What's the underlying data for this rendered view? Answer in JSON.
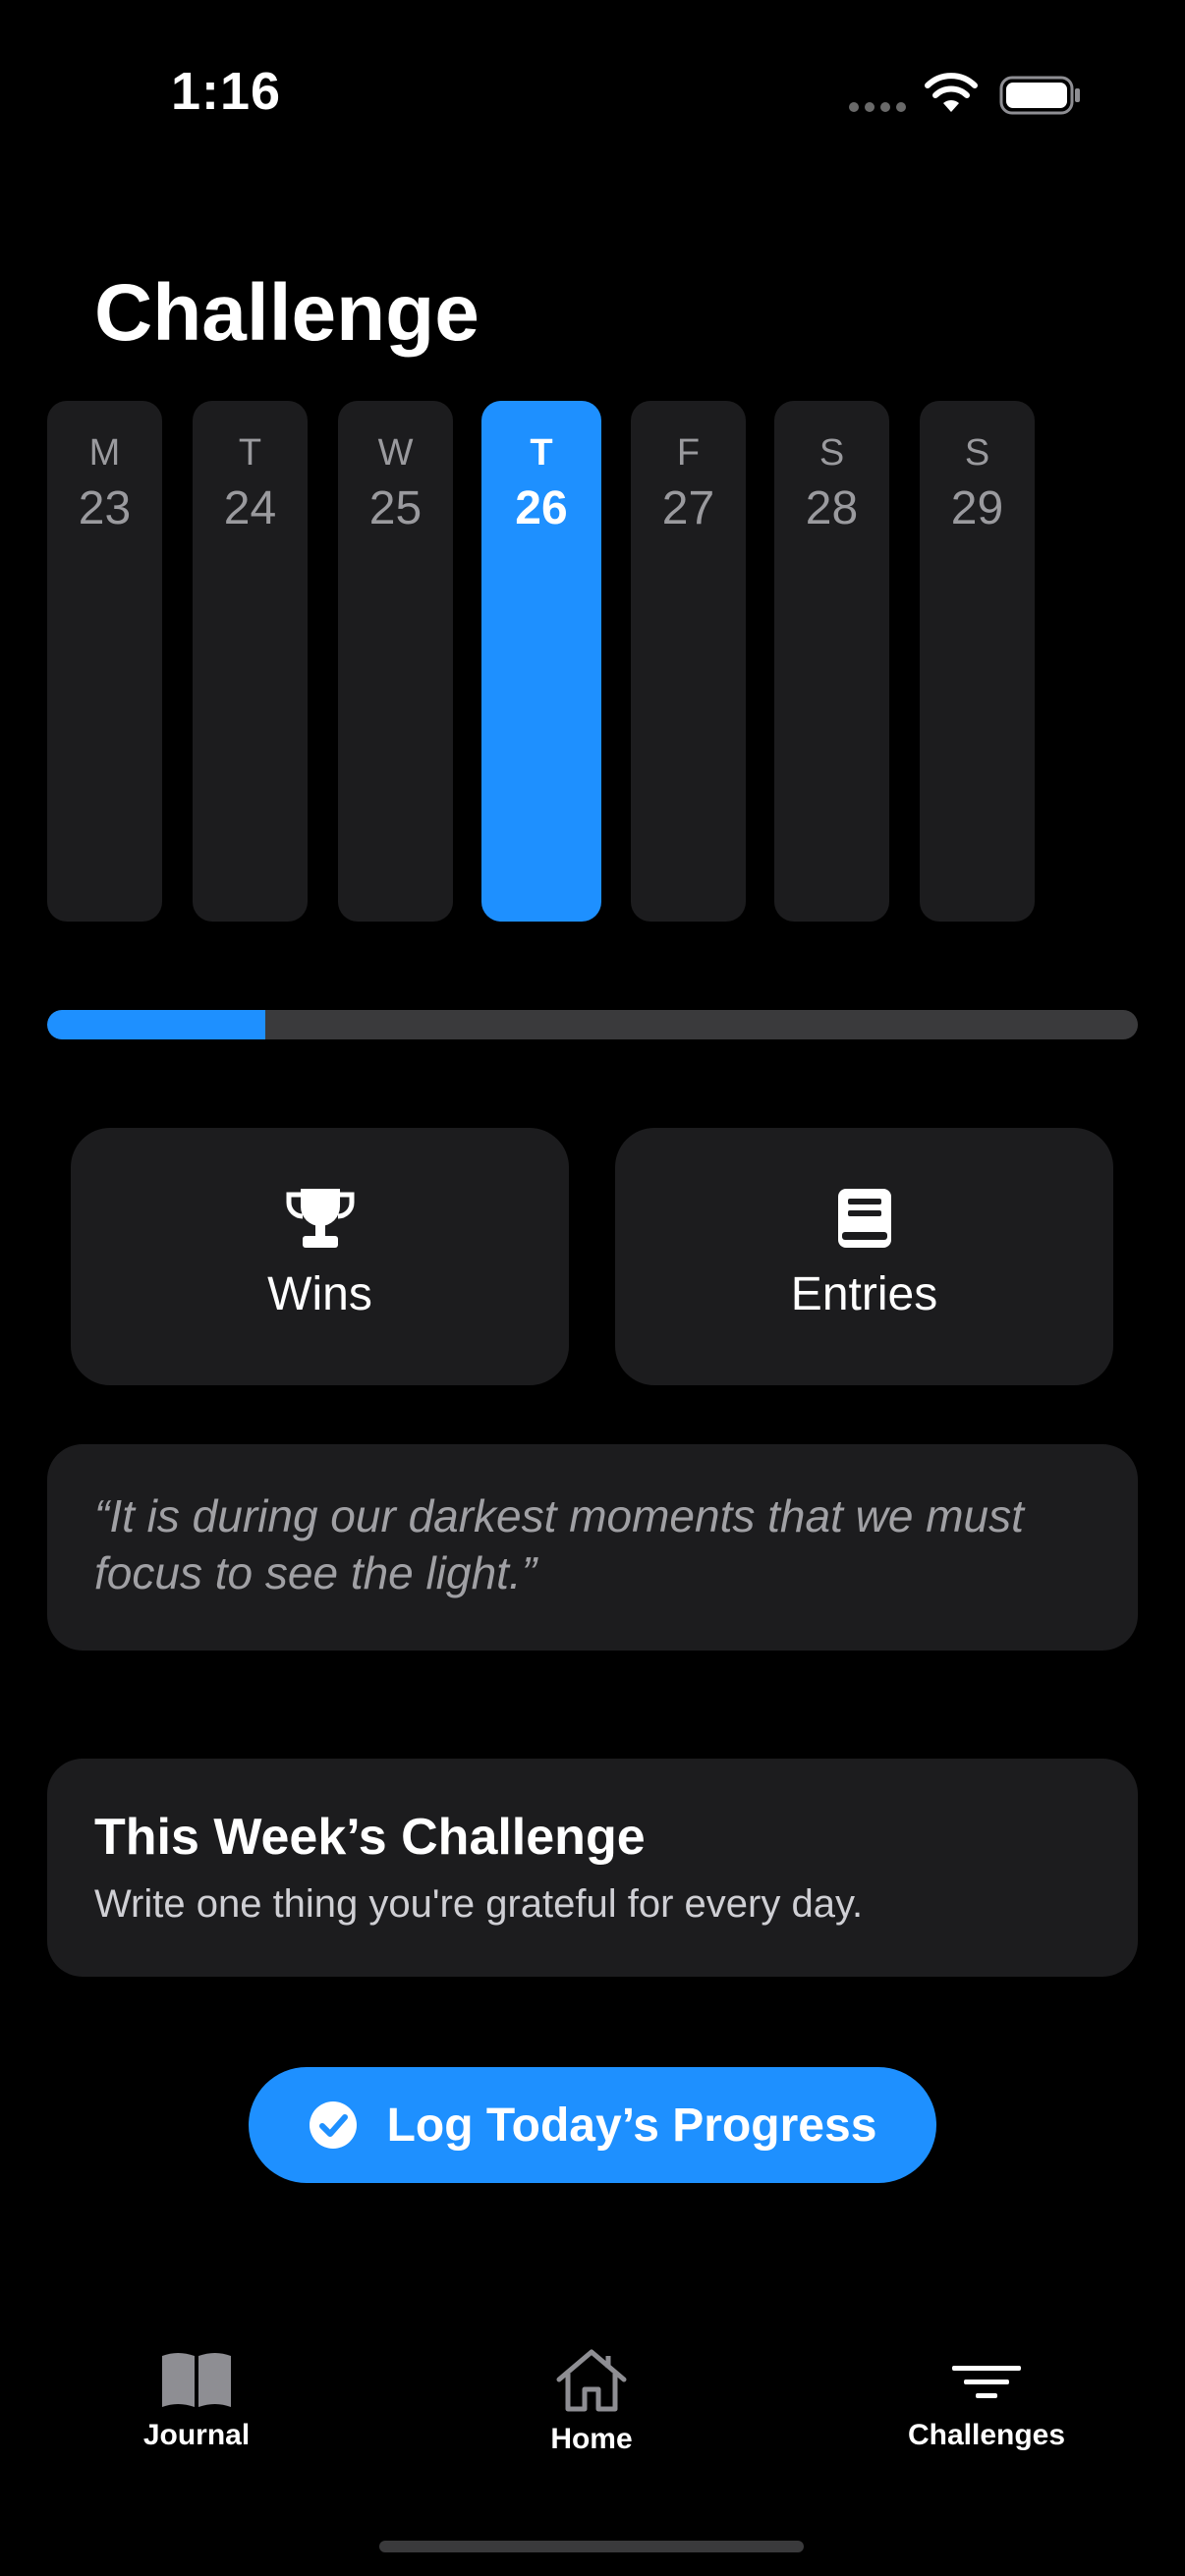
{
  "status_bar": {
    "time": "1:16"
  },
  "header": {
    "title": "Challenge"
  },
  "week": {
    "days": [
      {
        "dow": "M",
        "date": "23",
        "selected": false
      },
      {
        "dow": "T",
        "date": "24",
        "selected": false
      },
      {
        "dow": "W",
        "date": "25",
        "selected": false
      },
      {
        "dow": "T",
        "date": "26",
        "selected": true
      },
      {
        "dow": "F",
        "date": "27",
        "selected": false
      },
      {
        "dow": "S",
        "date": "28",
        "selected": false
      },
      {
        "dow": "S",
        "date": "29",
        "selected": false
      }
    ]
  },
  "progress": {
    "fraction": 0.2
  },
  "stats": {
    "wins": {
      "label": "Wins",
      "icon": "trophy-icon"
    },
    "entries": {
      "label": "Entries",
      "icon": "book-icon"
    }
  },
  "quote": {
    "text": "“It is during our darkest moments that we must focus to see the light.”"
  },
  "challenge": {
    "title": "This Week’s Challenge",
    "description": "Write one thing you're grateful for every day."
  },
  "cta": {
    "label": "Log Today’s Progress",
    "icon": "checkmark-circle-icon"
  },
  "tab_bar": {
    "journal": {
      "label": "Journal",
      "icon": "open-book-icon"
    },
    "home": {
      "label": "Home",
      "icon": "house-icon"
    },
    "challenges": {
      "label": "Challenges",
      "icon": "filter-lines-icon"
    }
  },
  "colors": {
    "accent": "#1E90FF",
    "card": "#1C1C1E",
    "background": "#000000"
  }
}
